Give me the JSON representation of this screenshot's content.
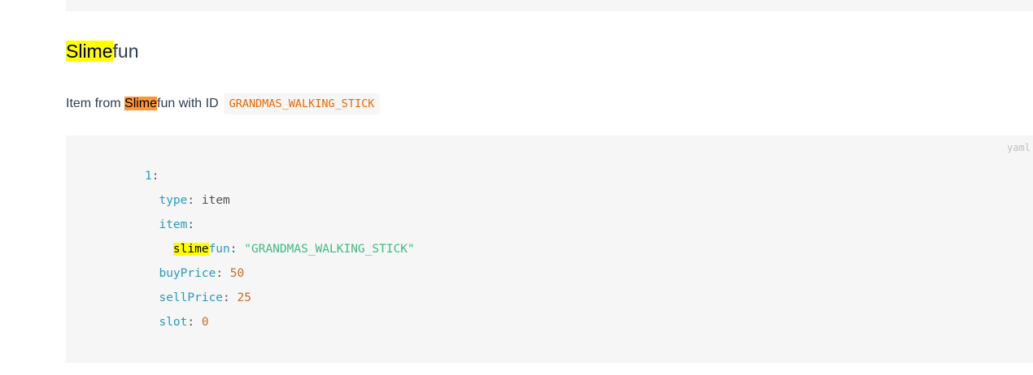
{
  "heading": {
    "highlight": "Slime",
    "rest": "fun"
  },
  "description": {
    "prefix": "Item from ",
    "highlight": "Slime",
    "suffix": "fun with ID",
    "item_id": "GRANDMAS_WALKING_STICK"
  },
  "code_block": {
    "language": "yaml",
    "lines": {
      "l1_key": "1",
      "l2_key": "type",
      "l2_value": "item",
      "l3_key": "item",
      "l4_key_highlight": "slime",
      "l4_key_rest": "fun",
      "l4_value": "\"GRANDMAS_WALKING_STICK\"",
      "l5_key": "buyPrice",
      "l5_value": "50",
      "l6_key": "sellPrice",
      "l6_value": "25",
      "l7_key": "slot",
      "l7_value": "0"
    }
  },
  "colors": {
    "search_highlight": "#ffff00",
    "current_match_highlight": "#ff9632",
    "inline_code_text": "#e96900",
    "yaml_key": "#2a9ab8",
    "yaml_number": "#c76b29",
    "yaml_string": "#42b983"
  }
}
